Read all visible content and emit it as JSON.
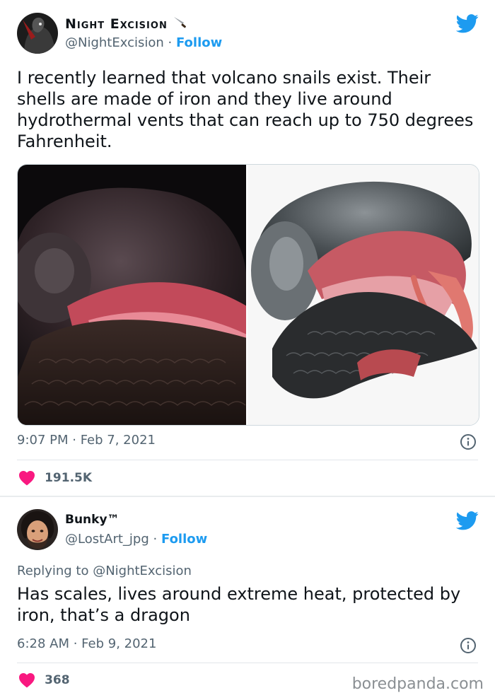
{
  "tweet1": {
    "display_name": "Night Excision",
    "handle": "@NightExcision",
    "separator": "·",
    "follow_label": "Follow",
    "text": "I recently learned that volcano snails exist. Their shells are made of iron and they live around hydrothermal vents that can reach up to 750 degrees Fahrenheit.",
    "timestamp": "9:07 PM · Feb 7, 2021",
    "likes": "191.5K"
  },
  "tweet2": {
    "display_name": "Bunky™",
    "handle": "@LostArt_jpg",
    "separator": "·",
    "follow_label": "Follow",
    "replying_to": "Replying to @NightExcision",
    "text": "Has scales, lives around extreme heat, protected by iron, that’s a dragon",
    "timestamp": "6:28 AM · Feb 9, 2021",
    "likes": "368"
  },
  "watermark": "boredpanda.com",
  "colors": {
    "accent": "#1d9bf0",
    "like": "#f91880",
    "secondary_text": "#536471"
  },
  "icons": {
    "brand": "twitter-bird-icon",
    "like": "heart-icon",
    "info": "info-icon",
    "name_emoji": "knife-icon"
  }
}
